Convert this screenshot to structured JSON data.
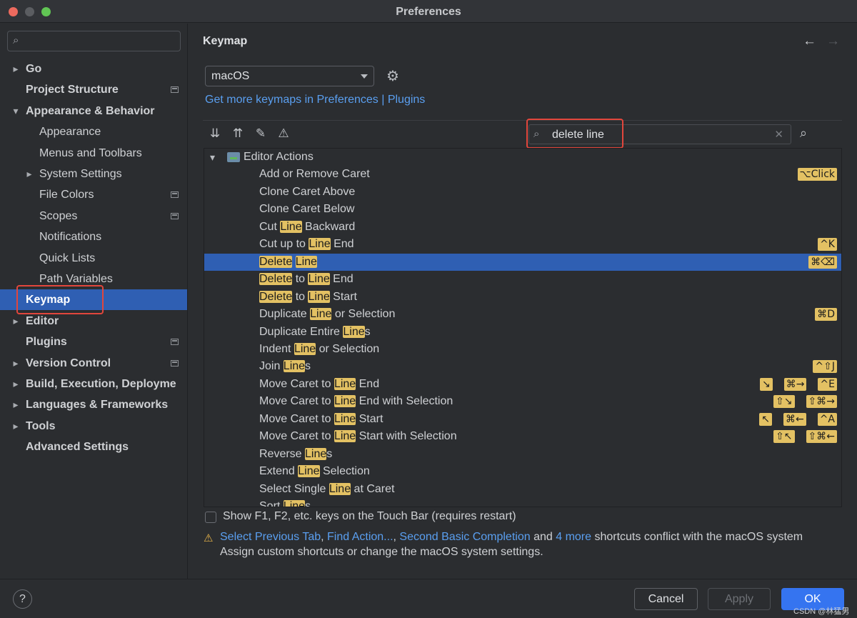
{
  "window": {
    "title": "Preferences"
  },
  "sidebar": {
    "search_placeholder": "",
    "items": [
      {
        "label": "Go",
        "level": 0,
        "chevron": "▸"
      },
      {
        "label": "Project Structure",
        "level": 0,
        "project": true
      },
      {
        "label": "Appearance & Behavior",
        "level": 0,
        "chevron": "▾"
      },
      {
        "label": "Appearance",
        "level": 1
      },
      {
        "label": "Menus and Toolbars",
        "level": 1
      },
      {
        "label": "System Settings",
        "level": 1,
        "chevron": "▸"
      },
      {
        "label": "File Colors",
        "level": 1,
        "project": true
      },
      {
        "label": "Scopes",
        "level": 1,
        "project": true
      },
      {
        "label": "Notifications",
        "level": 1
      },
      {
        "label": "Quick Lists",
        "level": 1
      },
      {
        "label": "Path Variables",
        "level": 1
      },
      {
        "label": "Keymap",
        "level": 0,
        "selected": true
      },
      {
        "label": "Editor",
        "level": 0,
        "chevron": "▸"
      },
      {
        "label": "Plugins",
        "level": 0,
        "project": true
      },
      {
        "label": "Version Control",
        "level": 0,
        "chevron": "▸",
        "project": true
      },
      {
        "label": "Build, Execution, Deployme",
        "level": 0,
        "chevron": "▸"
      },
      {
        "label": "Languages & Frameworks",
        "level": 0,
        "chevron": "▸"
      },
      {
        "label": "Tools",
        "level": 0,
        "chevron": "▸"
      },
      {
        "label": "Advanced Settings",
        "level": 0
      }
    ]
  },
  "main": {
    "title": "Keymap",
    "back_icon": "←",
    "forward_icon": "→",
    "keymap_select": "macOS",
    "gear_icon": "⚙",
    "more_keymaps_link": "Get more keymaps in Preferences | Plugins",
    "toolbar": {
      "expand_all": "⇊",
      "collapse_all": "⇈",
      "edit": "✎",
      "conflicts": "⚠",
      "search_icon": "⌕",
      "search_value": "delete line",
      "clear_icon": "✕",
      "find_shortcut_icon": "⌕"
    },
    "tree": {
      "group": {
        "chevron": "▾",
        "label": "Editor Actions"
      },
      "rows": [
        {
          "parts": [
            {
              "t": "Add or Remove Caret"
            }
          ],
          "shortcuts": [
            "⌥Click"
          ]
        },
        {
          "parts": [
            {
              "t": "Clone Caret Above"
            }
          ],
          "shortcuts": []
        },
        {
          "parts": [
            {
              "t": "Clone Caret Below"
            }
          ],
          "shortcuts": []
        },
        {
          "parts": [
            {
              "t": "Cut "
            },
            {
              "t": "Line",
              "h": true
            },
            {
              "t": " Backward"
            }
          ],
          "shortcuts": []
        },
        {
          "parts": [
            {
              "t": "Cut up to "
            },
            {
              "t": "Line",
              "h": true
            },
            {
              "t": " End"
            }
          ],
          "shortcuts": [
            "^K"
          ]
        },
        {
          "parts": [
            {
              "t": "Delete",
              "h": true
            },
            {
              "t": " "
            },
            {
              "t": "Line",
              "h": true
            }
          ],
          "shortcuts": [
            "⌘⌫"
          ],
          "selected": true
        },
        {
          "parts": [
            {
              "t": "Delete",
              "h": true
            },
            {
              "t": " to "
            },
            {
              "t": "Line",
              "h": true
            },
            {
              "t": " End"
            }
          ],
          "shortcuts": []
        },
        {
          "parts": [
            {
              "t": "Delete",
              "h": true
            },
            {
              "t": " to "
            },
            {
              "t": "Line",
              "h": true
            },
            {
              "t": " Start"
            }
          ],
          "shortcuts": []
        },
        {
          "parts": [
            {
              "t": "Duplicate "
            },
            {
              "t": "Line",
              "h": true
            },
            {
              "t": " or Selection"
            }
          ],
          "shortcuts": [
            "⌘D"
          ]
        },
        {
          "parts": [
            {
              "t": "Duplicate Entire "
            },
            {
              "t": "Line",
              "h": true
            },
            {
              "t": "s"
            }
          ],
          "shortcuts": []
        },
        {
          "parts": [
            {
              "t": "Indent "
            },
            {
              "t": "Line",
              "h": true
            },
            {
              "t": " or Selection"
            }
          ],
          "shortcuts": []
        },
        {
          "parts": [
            {
              "t": "Join "
            },
            {
              "t": "Line",
              "h": true
            },
            {
              "t": "s"
            }
          ],
          "shortcuts": [
            "^⇧J"
          ]
        },
        {
          "parts": [
            {
              "t": "Move Caret to "
            },
            {
              "t": "Line",
              "h": true
            },
            {
              "t": " End"
            }
          ],
          "shortcuts": [
            "↘",
            "⌘→",
            "^E"
          ]
        },
        {
          "parts": [
            {
              "t": "Move Caret to "
            },
            {
              "t": "Line",
              "h": true
            },
            {
              "t": " End with Selection"
            }
          ],
          "shortcuts": [
            "⇧↘",
            "⇧⌘→"
          ]
        },
        {
          "parts": [
            {
              "t": "Move Caret to "
            },
            {
              "t": "Line",
              "h": true
            },
            {
              "t": " Start"
            }
          ],
          "shortcuts": [
            "↖",
            "⌘←",
            "^A"
          ]
        },
        {
          "parts": [
            {
              "t": "Move Caret to "
            },
            {
              "t": "Line",
              "h": true
            },
            {
              "t": " Start with Selection"
            }
          ],
          "shortcuts": [
            "⇧↖",
            "⇧⌘←"
          ]
        },
        {
          "parts": [
            {
              "t": "Reverse "
            },
            {
              "t": "Line",
              "h": true
            },
            {
              "t": "s"
            }
          ],
          "shortcuts": []
        },
        {
          "parts": [
            {
              "t": "Extend "
            },
            {
              "t": "Line",
              "h": true
            },
            {
              "t": " Selection"
            }
          ],
          "shortcuts": []
        },
        {
          "parts": [
            {
              "t": "Select Single "
            },
            {
              "t": "Line",
              "h": true
            },
            {
              "t": " at Caret"
            }
          ],
          "shortcuts": []
        },
        {
          "parts": [
            {
              "t": "Sort "
            },
            {
              "t": "Line",
              "h": true
            },
            {
              "t": "s"
            }
          ],
          "shortcuts": []
        }
      ]
    },
    "touchbar_checkbox": {
      "label": "Show F1, F2, etc. keys on the Touch Bar (requires restart)",
      "checked": false
    },
    "conflict_warning": {
      "icon": "⚠",
      "link1": "Select Previous Tab",
      "sep1": ", ",
      "link2": "Find Action...",
      "sep2": ", ",
      "link3": "Second Basic Completion",
      "and": " and ",
      "link4": "4 more",
      "rest": " shortcuts conflict with the macOS system",
      "line2": "Assign custom shortcuts or change the macOS system settings."
    }
  },
  "footer": {
    "help": "?",
    "cancel": "Cancel",
    "apply": "Apply",
    "ok": "OK",
    "watermark": "CSDN @林猛男"
  },
  "colors": {
    "accent": "#2f5fb3",
    "highlight": "#e3c163",
    "link": "#5a9ff0",
    "annotation": "#e2463c"
  }
}
